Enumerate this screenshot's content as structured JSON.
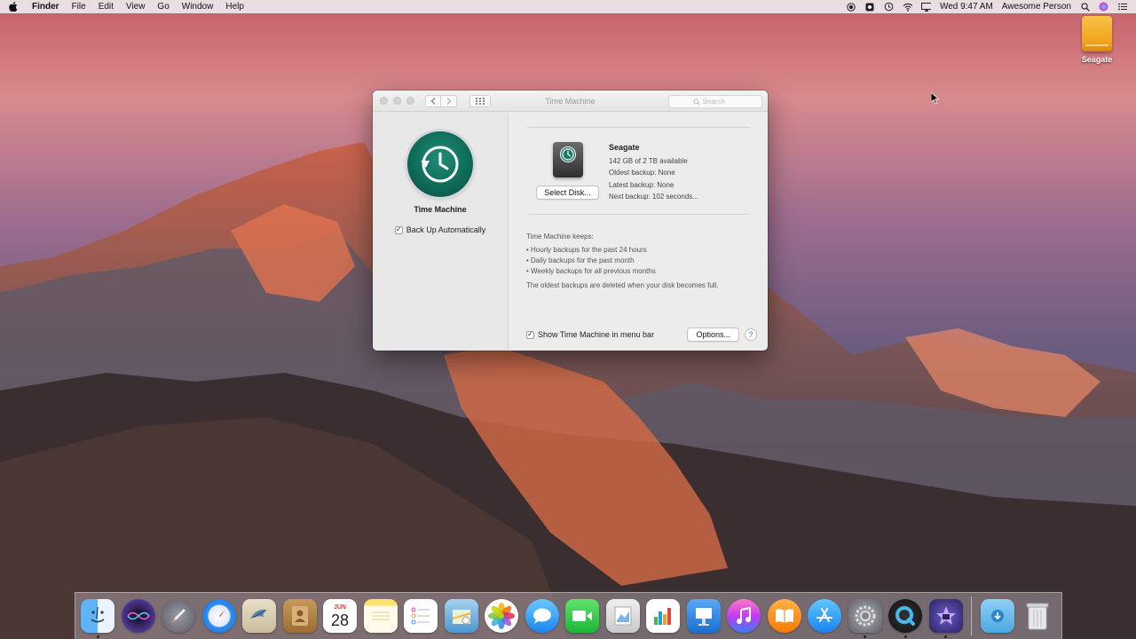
{
  "menubar": {
    "app_name": "Finder",
    "items": [
      "File",
      "Edit",
      "View",
      "Go",
      "Window",
      "Help"
    ],
    "clock": "Wed 9:47 AM",
    "user": "Awesome Person",
    "status_icons": [
      "record-icon",
      "screen-icon",
      "time-machine-icon",
      "wifi-icon",
      "airplay-icon",
      "search-icon",
      "siri-icon",
      "list-icon"
    ]
  },
  "desktop": {
    "drive_label": "Seagate"
  },
  "window": {
    "title": "Time Machine",
    "search_placeholder": "Search",
    "app_label": "Time Machine",
    "back_up_automatically": "Back Up Automatically",
    "disk": {
      "name": "Seagate",
      "available": "142 GB of 2 TB available",
      "oldest": "Oldest backup: None",
      "latest": "Latest backup: None",
      "next": "Next backup: 102 seconds..."
    },
    "select_disk_button": "Select Disk...",
    "keeps": {
      "header": "Time Machine keeps:",
      "items": [
        "• Hourly backups for the past 24 hours",
        "• Daily backups for the past month",
        "• Weekly backups for all previous months"
      ],
      "note": "The oldest backups are deleted when your disk becomes full."
    },
    "show_in_menu_bar": "Show Time Machine in menu bar",
    "options_button": "Options...",
    "help_button": "?"
  },
  "dock": {
    "calendar_month": "JUN",
    "calendar_day": "28"
  },
  "colors": {
    "tm_green": "#0f6b59",
    "drive_orange": "#f3a51d"
  }
}
